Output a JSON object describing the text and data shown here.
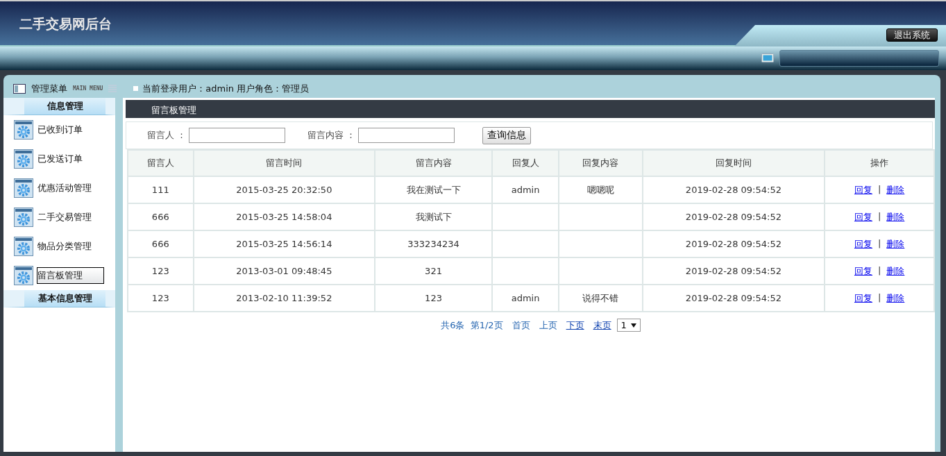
{
  "header": {
    "title": "二手交易网后台",
    "logout": "退出系统"
  },
  "menu_bar": {
    "title": "管理菜单",
    "subtitle": "MAIN MENU",
    "user_info": "当前登录用户：admin  用户角色：管理员"
  },
  "sidebar": {
    "groups": [
      {
        "title": "信息管理",
        "items": [
          {
            "label": "已收到订单",
            "selected": false
          },
          {
            "label": "已发送订单",
            "selected": false
          },
          {
            "label": "优惠活动管理",
            "selected": false
          },
          {
            "label": "二手交易管理",
            "selected": false
          },
          {
            "label": "物品分类管理",
            "selected": false
          },
          {
            "label": "留言板管理",
            "selected": true
          }
        ]
      },
      {
        "title": "基本信息管理"
      }
    ]
  },
  "panel": {
    "title": "留言板管理"
  },
  "search": {
    "fields": [
      {
        "label": "留言人 ："
      },
      {
        "label": "留言内容 ："
      }
    ],
    "button": "查询信息"
  },
  "table": {
    "columns": [
      "留言人",
      "留言时间",
      "留言内容",
      "回复人",
      "回复内容",
      "回复时间",
      "操作"
    ],
    "rows": [
      {
        "cells": [
          "111",
          "2015-03-25 20:32:50",
          "我在测试一下",
          "admin",
          "嗯嗯呢",
          "2019-02-28 09:54:52"
        ],
        "actions": [
          "回复",
          "删除"
        ]
      },
      {
        "cells": [
          "666",
          "2015-03-25 14:58:04",
          "我测试下",
          "",
          "",
          "2019-02-28 09:54:52"
        ],
        "actions": [
          "回复",
          "删除"
        ]
      },
      {
        "cells": [
          "666",
          "2015-03-25 14:56:14",
          "333234234",
          "",
          "",
          "2019-02-28 09:54:52"
        ],
        "actions": [
          "回复",
          "删除"
        ]
      },
      {
        "cells": [
          "123",
          "2013-03-01 09:48:45",
          "321",
          "",
          "",
          "2019-02-28 09:54:52"
        ],
        "actions": [
          "回复",
          "删除"
        ]
      },
      {
        "cells": [
          "123",
          "2013-02-10 11:39:52",
          "123",
          "admin",
          "说得不错",
          "2019-02-28 09:54:52"
        ],
        "actions": [
          "回复",
          "删除"
        ]
      }
    ],
    "action_separator": "|"
  },
  "pagination": {
    "summary": "共6条  第1/2页",
    "links": [
      {
        "label": "首页",
        "disabled": true
      },
      {
        "label": "上页",
        "disabled": true
      },
      {
        "label": "下页",
        "disabled": false
      },
      {
        "label": "末页",
        "disabled": false
      }
    ],
    "page_select": "1"
  }
}
